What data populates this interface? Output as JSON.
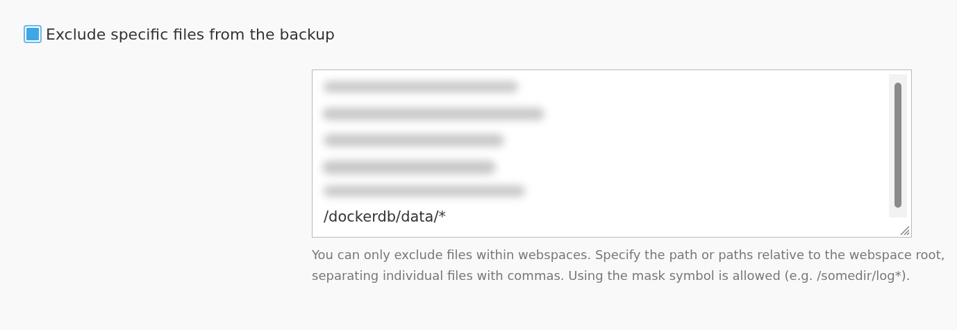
{
  "option": {
    "label": "Exclude specific files from the backup",
    "checked": true
  },
  "exclude_field": {
    "value": "/dockerdb/data/*"
  },
  "help_text": "You can only exclude files within webspaces. Specify the path or paths relative to the webspace root, separating individual files with commas. Using the mask symbol is allowed (e.g. /somedir/log*)."
}
